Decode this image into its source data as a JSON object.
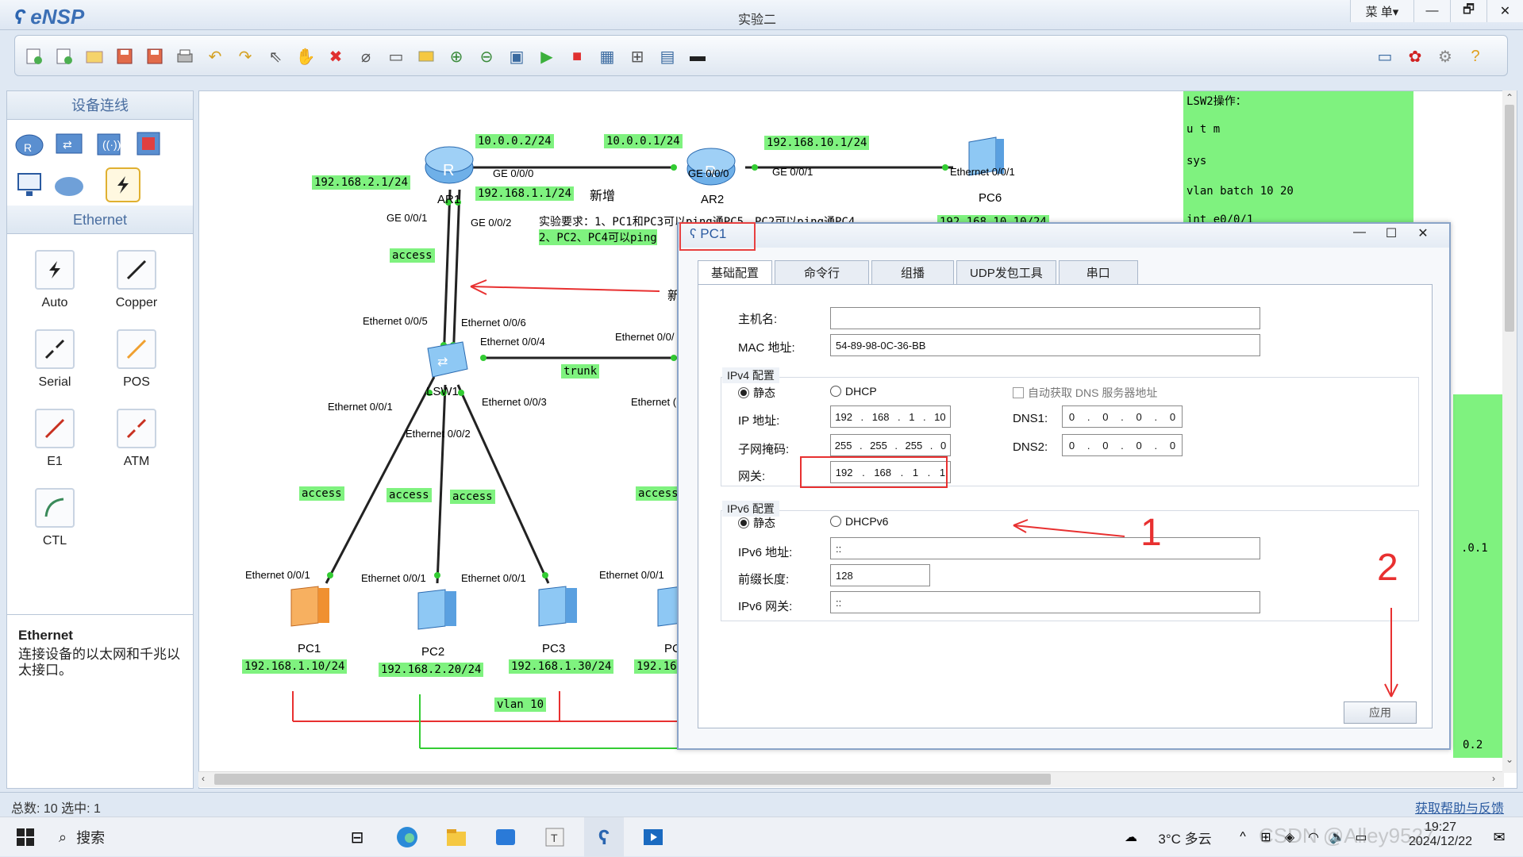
{
  "app": {
    "name": "eNSP",
    "title": "实验二",
    "menu_label": "菜 单▾"
  },
  "window_buttons": {
    "minimize": "—",
    "restore": "🗗",
    "close": "✕"
  },
  "left_panel": {
    "header": "设备连线",
    "ethernet_header": "Ethernet",
    "cables": [
      {
        "label": "Auto"
      },
      {
        "label": "Copper"
      },
      {
        "label": "Serial"
      },
      {
        "label": "POS"
      },
      {
        "label": "E1"
      },
      {
        "label": "ATM"
      },
      {
        "label": "CTL"
      }
    ],
    "desc_title": "Ethernet",
    "desc_text": "连接设备的以太网和千兆以太接口。"
  },
  "topology": {
    "ip_labels": {
      "ar1_ge000": "10.0.0.2/24",
      "ar2_ge000": "10.0.0.1/24",
      "ar2_ge001": "192.168.10.1/24",
      "ar1_ge001": "192.168.2.1/24",
      "ar1_ge002": "192.168.1.1/24",
      "pc6_ip": "192.168.10.10/24",
      "pc1_ip": "192.168.1.10/24",
      "pc2_ip": "192.168.2.20/24",
      "pc3_ip": "192.168.1.30/24",
      "pc4_ip": "192.168.1"
    },
    "new_label": "新增",
    "new_label2": "新",
    "requirement_line1": "实验要求：1、PC1和PC3可以ping通PC5，PC2可以ping通PC4",
    "requirement_line2": "2、PC2、PC4可以ping",
    "nodes": {
      "ar1": "AR1",
      "ar2": "AR2",
      "pc6": "PC6",
      "lsw1": "LSW1",
      "pc1": "PC1",
      "pc2": "PC2",
      "pc3": "PC3",
      "pc4": "PC"
    },
    "ports": {
      "ar1_ge000": "GE 0/0/0",
      "ar2_ge000": "GE 0/0/0",
      "ar2_ge001": "GE 0/0/1",
      "pc6_eth": "Ethernet 0/0/1",
      "ar1_ge001": "GE 0/0/1",
      "ar1_ge002": "GE 0/0/2",
      "lsw_e005": "Ethernet 0/0/5",
      "lsw_e006": "Ethernet 0/0/6",
      "lsw_e004": "Ethernet 0/0/4",
      "lsw2_e00": "Ethernet 0/0/",
      "lsw_e001": "Ethernet 0/0/1",
      "lsw_e003": "Ethernet 0/0/3",
      "lsw_e002": "Ethernet 0/0/2",
      "lsw2_e0": "Ethernet (",
      "pc1_eth": "Ethernet 0/0/1",
      "pc2_eth": "Ethernet 0/0/1",
      "pc3_eth": "Ethernet 0/0/1",
      "pc4_eth": "Ethernet 0/0/1"
    },
    "mode_labels": {
      "uplink": "access",
      "trunk": "trunk",
      "pc1": "access",
      "pc2": "access",
      "pc3": "access",
      "pc4": "access"
    },
    "vlan_label": "vlan 10"
  },
  "notes_panel": {
    "lines": [
      "LSW2操作：",
      "u t m",
      "sys",
      "vlan batch 10 20",
      "int e0/0/1"
    ],
    "right_frag1": ".0.1",
    "right_frag2": "0.2"
  },
  "dialog": {
    "title": "PC1",
    "tabs": [
      "基础配置",
      "命令行",
      "组播",
      "UDP发包工具",
      "串口"
    ],
    "hostname_label": "主机名:",
    "hostname_value": "",
    "mac_label": "MAC 地址:",
    "mac_value": "54-89-98-0C-36-BB",
    "ipv4_section": "IPv4 配置",
    "static_label": "静态",
    "dhcp_label": "DHCP",
    "auto_dns_label": "自动获取 DNS 服务器地址",
    "ip_label": "IP 地址:",
    "ip_value": [
      "192",
      "168",
      "1",
      "10"
    ],
    "mask_label": "子网掩码:",
    "mask_value": [
      "255",
      "255",
      "255",
      "0"
    ],
    "gateway_label": "网关:",
    "gateway_value": [
      "192",
      "168",
      "1",
      "1"
    ],
    "dns1_label": "DNS1:",
    "dns1_value": [
      "0",
      "0",
      "0",
      "0"
    ],
    "dns2_label": "DNS2:",
    "dns2_value": [
      "0",
      "0",
      "0",
      "0"
    ],
    "ipv6_section": "IPv6 配置",
    "static6_label": "静态",
    "dhcpv6_label": "DHCPv6",
    "ipv6_label": "IPv6 地址:",
    "ipv6_value": "::",
    "prefix_label": "前缀长度:",
    "prefix_value": "128",
    "ipv6_gw_label": "IPv6 网关:",
    "ipv6_gw_value": "::",
    "apply_label": "应用",
    "annotation_1": "1",
    "annotation_2": "2"
  },
  "statusbar": {
    "left": "总数: 10 选中: 1",
    "right": "获取帮助与反馈"
  },
  "taskbar": {
    "search": "搜索",
    "weather": "3°C 多云",
    "time": "19:27",
    "date": "2024/12/22",
    "watermark": "CSDN @Alley9527"
  }
}
